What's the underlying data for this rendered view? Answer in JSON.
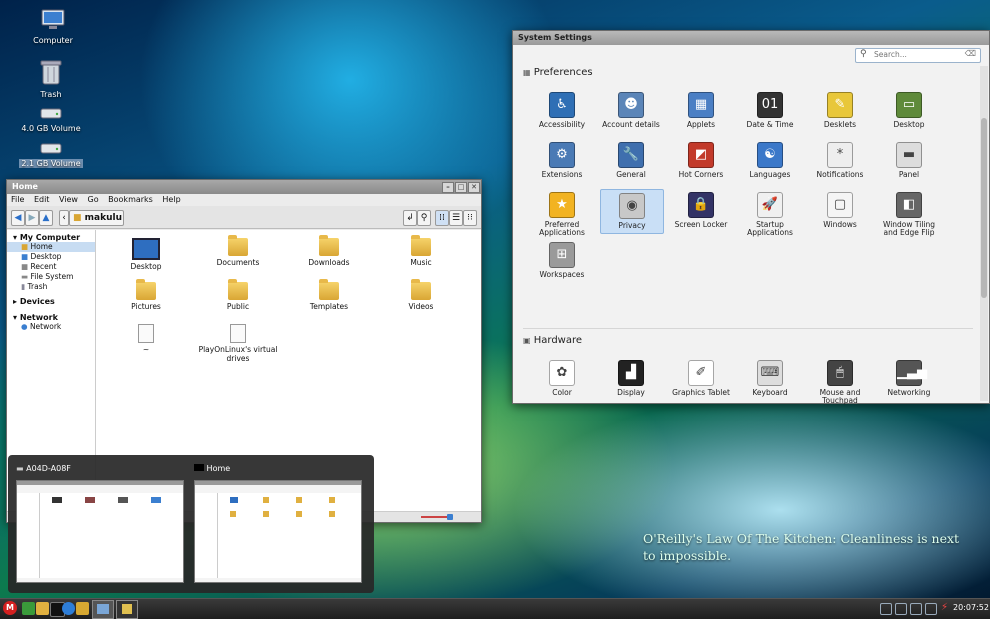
{
  "desktop": {
    "icons": [
      {
        "label": "Computer",
        "icon": "computer-icon"
      },
      {
        "label": "Trash",
        "icon": "trash-icon"
      },
      {
        "label": "4.0 GB Volume",
        "icon": "drive-icon"
      },
      {
        "label": "2.1 GB Volume",
        "icon": "drive-icon"
      }
    ],
    "quote": "O'Reilly's Law Of The Kitchen: Cleanliness is next to impossible."
  },
  "file_manager": {
    "title": "Home",
    "menu": [
      "File",
      "Edit",
      "View",
      "Go",
      "Bookmarks",
      "Help"
    ],
    "location": "makulu",
    "sidebar": {
      "my_computer": "My Computer",
      "my_computer_items": [
        "Home",
        "Desktop",
        "Recent",
        "File System",
        "Trash"
      ],
      "devices": "Devices",
      "network": "Network",
      "network_items": [
        "Network"
      ]
    },
    "files": [
      "Desktop",
      "Documents",
      "Downloads",
      "Music",
      "Pictures",
      "Public",
      "Templates",
      "Videos",
      "~",
      "PlayOnLinux's virtual drives"
    ]
  },
  "system_settings": {
    "title": "System Settings",
    "search_placeholder": "Search...",
    "preferences_label": "Preferences",
    "hardware_label": "Hardware",
    "preferences": [
      {
        "label": "Accessibility",
        "color": "#2f6fb5",
        "glyph": "♿"
      },
      {
        "label": "Account details",
        "color": "#5b85b8",
        "glyph": "☻"
      },
      {
        "label": "Applets",
        "color": "#4b7fc4",
        "glyph": "▦"
      },
      {
        "label": "Date & Time",
        "color": "#333333",
        "glyph": "01"
      },
      {
        "label": "Desklets",
        "color": "#e8c73a",
        "glyph": "✎"
      },
      {
        "label": "Desktop",
        "color": "#5f8a3a",
        "glyph": "▭"
      },
      {
        "label": "Extensions",
        "color": "#4a7ab5",
        "glyph": "⚙"
      },
      {
        "label": "General",
        "color": "#3f6fae",
        "glyph": "🔧"
      },
      {
        "label": "Hot Corners",
        "color": "#c23a2a",
        "glyph": "◩"
      },
      {
        "label": "Languages",
        "color": "#3b78c9",
        "glyph": "☯"
      },
      {
        "label": "Notifications",
        "color": "#eeeeee",
        "glyph": "*"
      },
      {
        "label": "Panel",
        "color": "#dddddd",
        "glyph": "▬"
      },
      {
        "label": "Preferred Applications",
        "color": "#f2b322",
        "glyph": "★"
      },
      {
        "label": "Privacy",
        "color": "#c8c8c8",
        "glyph": "◉"
      },
      {
        "label": "Screen Locker",
        "color": "#333366",
        "glyph": "🔒"
      },
      {
        "label": "Startup Applications",
        "color": "#f0f0f0",
        "glyph": "🚀"
      },
      {
        "label": "Windows",
        "color": "#f5f5f5",
        "glyph": "▢"
      },
      {
        "label": "Window Tiling and Edge Flip",
        "color": "#666666",
        "glyph": "◧"
      },
      {
        "label": "Workspaces",
        "color": "#9a9a9a",
        "glyph": "⊞"
      }
    ],
    "hardware": [
      {
        "label": "Color",
        "color": "#ffffff",
        "glyph": "✿"
      },
      {
        "label": "Display",
        "color": "#222222",
        "glyph": "▟"
      },
      {
        "label": "Graphics Tablet",
        "color": "#ffffff",
        "glyph": "✐"
      },
      {
        "label": "Keyboard",
        "color": "#dddddd",
        "glyph": "⌨"
      },
      {
        "label": "Mouse and Touchpad",
        "color": "#444444",
        "glyph": "🖱"
      },
      {
        "label": "Networking",
        "color": "#555555",
        "glyph": "▁▃▅"
      }
    ]
  },
  "switcher": {
    "windows": [
      {
        "title": "A04D-A08F"
      },
      {
        "title": "Home"
      }
    ]
  },
  "taskbar": {
    "menu_label": "M",
    "clock": "20:07:52"
  }
}
